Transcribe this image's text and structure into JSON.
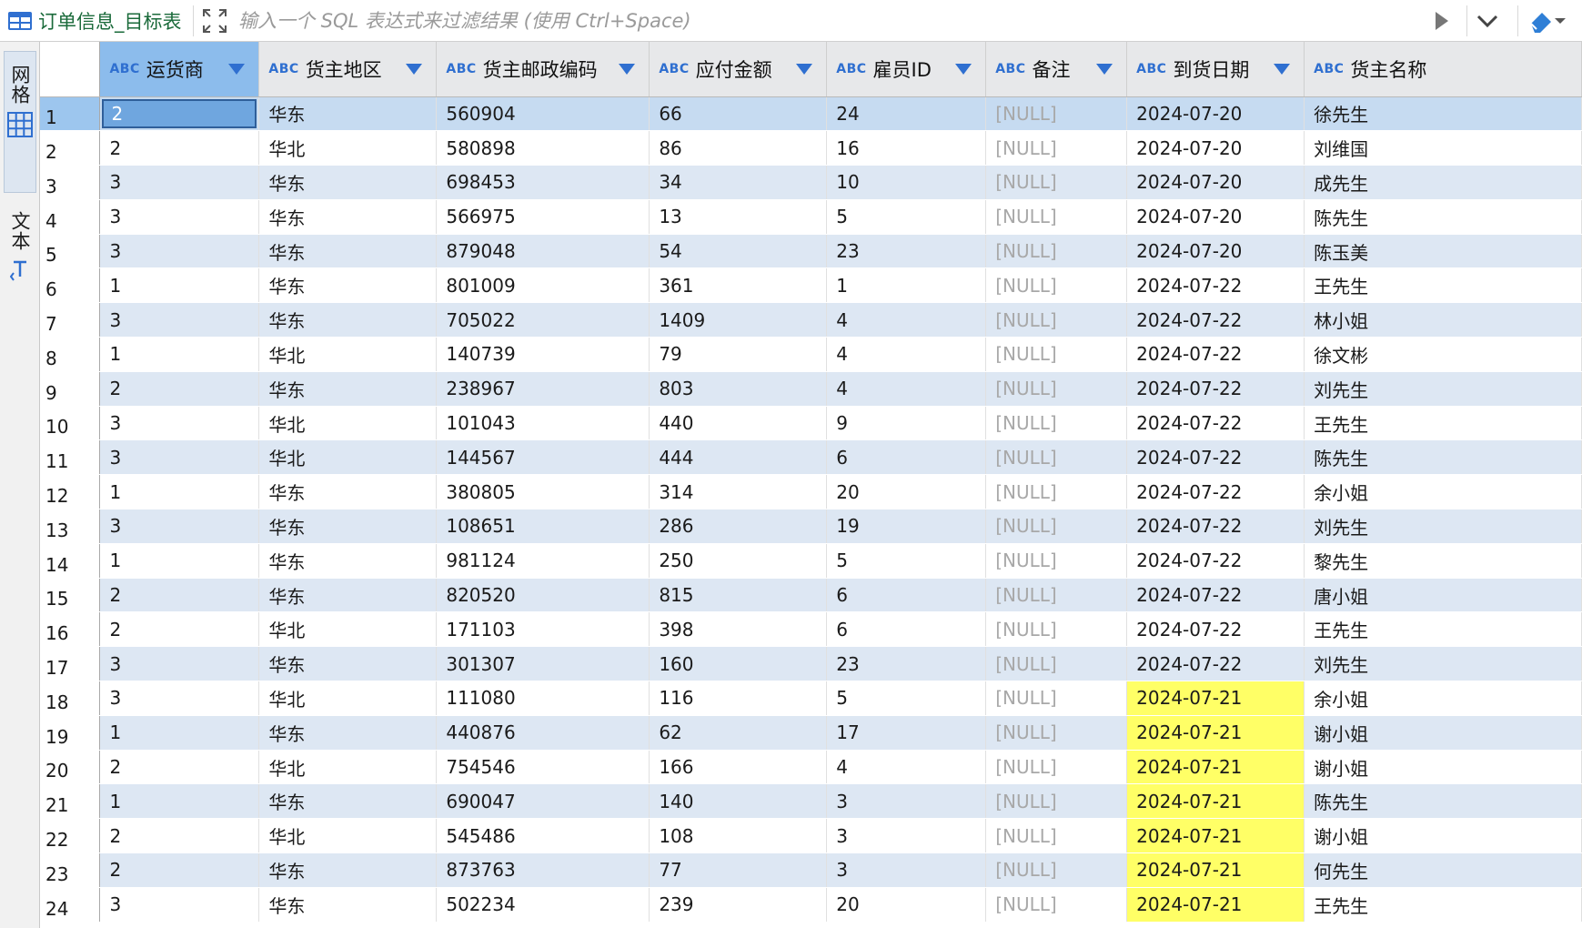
{
  "toolbar": {
    "table_name": "订单信息_目标表",
    "table_icon": "table-grid-icon",
    "filter_placeholder": "输入一个 SQL 表达式来过滤结果 (使用 Ctrl+Space)",
    "expand_icon": "expand-arrows-icon",
    "run_icon": "play-icon",
    "history_icon": "chevron-down-icon",
    "clear_icon": "eraser-icon"
  },
  "side_panel": {
    "grid_label": "网格",
    "text_label": "文本",
    "grid_icon": "grid-icon",
    "text_icon": "text-mode-icon"
  },
  "columns": [
    {
      "type": "ABC",
      "name": "运货商"
    },
    {
      "type": "ABC",
      "name": "货主地区"
    },
    {
      "type": "ABC",
      "name": "货主邮政编码"
    },
    {
      "type": "ABC",
      "name": "应付金额"
    },
    {
      "type": "ABC",
      "name": "雇员ID"
    },
    {
      "type": "ABC",
      "name": "备注"
    },
    {
      "type": "ABC",
      "name": "到货日期"
    },
    {
      "type": "ABC",
      "name": "货主名称"
    }
  ],
  "rows": [
    {
      "n": "1",
      "cells": [
        "2",
        "华东",
        "560904",
        "66",
        "24",
        "[NULL]",
        "2024-07-20",
        "徐先生"
      ]
    },
    {
      "n": "2",
      "cells": [
        "2",
        "华北",
        "580898",
        "86",
        "16",
        "[NULL]",
        "2024-07-20",
        "刘维国"
      ]
    },
    {
      "n": "3",
      "cells": [
        "3",
        "华东",
        "698453",
        "34",
        "10",
        "[NULL]",
        "2024-07-20",
        "成先生"
      ]
    },
    {
      "n": "4",
      "cells": [
        "3",
        "华东",
        "566975",
        "13",
        "5",
        "[NULL]",
        "2024-07-20",
        "陈先生"
      ]
    },
    {
      "n": "5",
      "cells": [
        "3",
        "华东",
        "879048",
        "54",
        "23",
        "[NULL]",
        "2024-07-20",
        "陈玉美"
      ]
    },
    {
      "n": "6",
      "cells": [
        "1",
        "华东",
        "801009",
        "361",
        "1",
        "[NULL]",
        "2024-07-22",
        "王先生"
      ]
    },
    {
      "n": "7",
      "cells": [
        "3",
        "华东",
        "705022",
        "1409",
        "4",
        "[NULL]",
        "2024-07-22",
        "林小姐"
      ]
    },
    {
      "n": "8",
      "cells": [
        "1",
        "华北",
        "140739",
        "79",
        "4",
        "[NULL]",
        "2024-07-22",
        "徐文彬"
      ]
    },
    {
      "n": "9",
      "cells": [
        "2",
        "华东",
        "238967",
        "803",
        "4",
        "[NULL]",
        "2024-07-22",
        "刘先生"
      ]
    },
    {
      "n": "10",
      "cells": [
        "3",
        "华北",
        "101043",
        "440",
        "9",
        "[NULL]",
        "2024-07-22",
        "王先生"
      ]
    },
    {
      "n": "11",
      "cells": [
        "3",
        "华北",
        "144567",
        "444",
        "6",
        "[NULL]",
        "2024-07-22",
        "陈先生"
      ]
    },
    {
      "n": "12",
      "cells": [
        "1",
        "华东",
        "380805",
        "314",
        "20",
        "[NULL]",
        "2024-07-22",
        "余小姐"
      ]
    },
    {
      "n": "13",
      "cells": [
        "3",
        "华东",
        "108651",
        "286",
        "19",
        "[NULL]",
        "2024-07-22",
        "刘先生"
      ]
    },
    {
      "n": "14",
      "cells": [
        "1",
        "华东",
        "981124",
        "250",
        "5",
        "[NULL]",
        "2024-07-22",
        "黎先生"
      ]
    },
    {
      "n": "15",
      "cells": [
        "2",
        "华东",
        "820520",
        "815",
        "6",
        "[NULL]",
        "2024-07-22",
        "唐小姐"
      ]
    },
    {
      "n": "16",
      "cells": [
        "2",
        "华北",
        "171103",
        "398",
        "6",
        "[NULL]",
        "2024-07-22",
        "王先生"
      ]
    },
    {
      "n": "17",
      "cells": [
        "3",
        "华东",
        "301307",
        "160",
        "23",
        "[NULL]",
        "2024-07-22",
        "刘先生"
      ]
    },
    {
      "n": "18",
      "cells": [
        "3",
        "华北",
        "111080",
        "116",
        "5",
        "[NULL]",
        "2024-07-21",
        "余小姐"
      ]
    },
    {
      "n": "19",
      "cells": [
        "1",
        "华东",
        "440876",
        "62",
        "17",
        "[NULL]",
        "2024-07-21",
        "谢小姐"
      ]
    },
    {
      "n": "20",
      "cells": [
        "2",
        "华北",
        "754546",
        "166",
        "4",
        "[NULL]",
        "2024-07-21",
        "谢小姐"
      ]
    },
    {
      "n": "21",
      "cells": [
        "1",
        "华东",
        "690047",
        "140",
        "3",
        "[NULL]",
        "2024-07-21",
        "陈先生"
      ]
    },
    {
      "n": "22",
      "cells": [
        "2",
        "华北",
        "545486",
        "108",
        "3",
        "[NULL]",
        "2024-07-21",
        "谢小姐"
      ]
    },
    {
      "n": "23",
      "cells": [
        "2",
        "华东",
        "873763",
        "77",
        "3",
        "[NULL]",
        "2024-07-21",
        "何先生"
      ]
    },
    {
      "n": "24",
      "cells": [
        "3",
        "华东",
        "502234",
        "239",
        "20",
        "[NULL]",
        "2024-07-21",
        "王先生"
      ]
    }
  ],
  "highlighted_date": "2024-07-21",
  "colors": {
    "highlight": "#ffff66",
    "row_stripe": "#dde7f3",
    "selection": "#6fa6df",
    "type_badge": "#2f6fd0"
  }
}
